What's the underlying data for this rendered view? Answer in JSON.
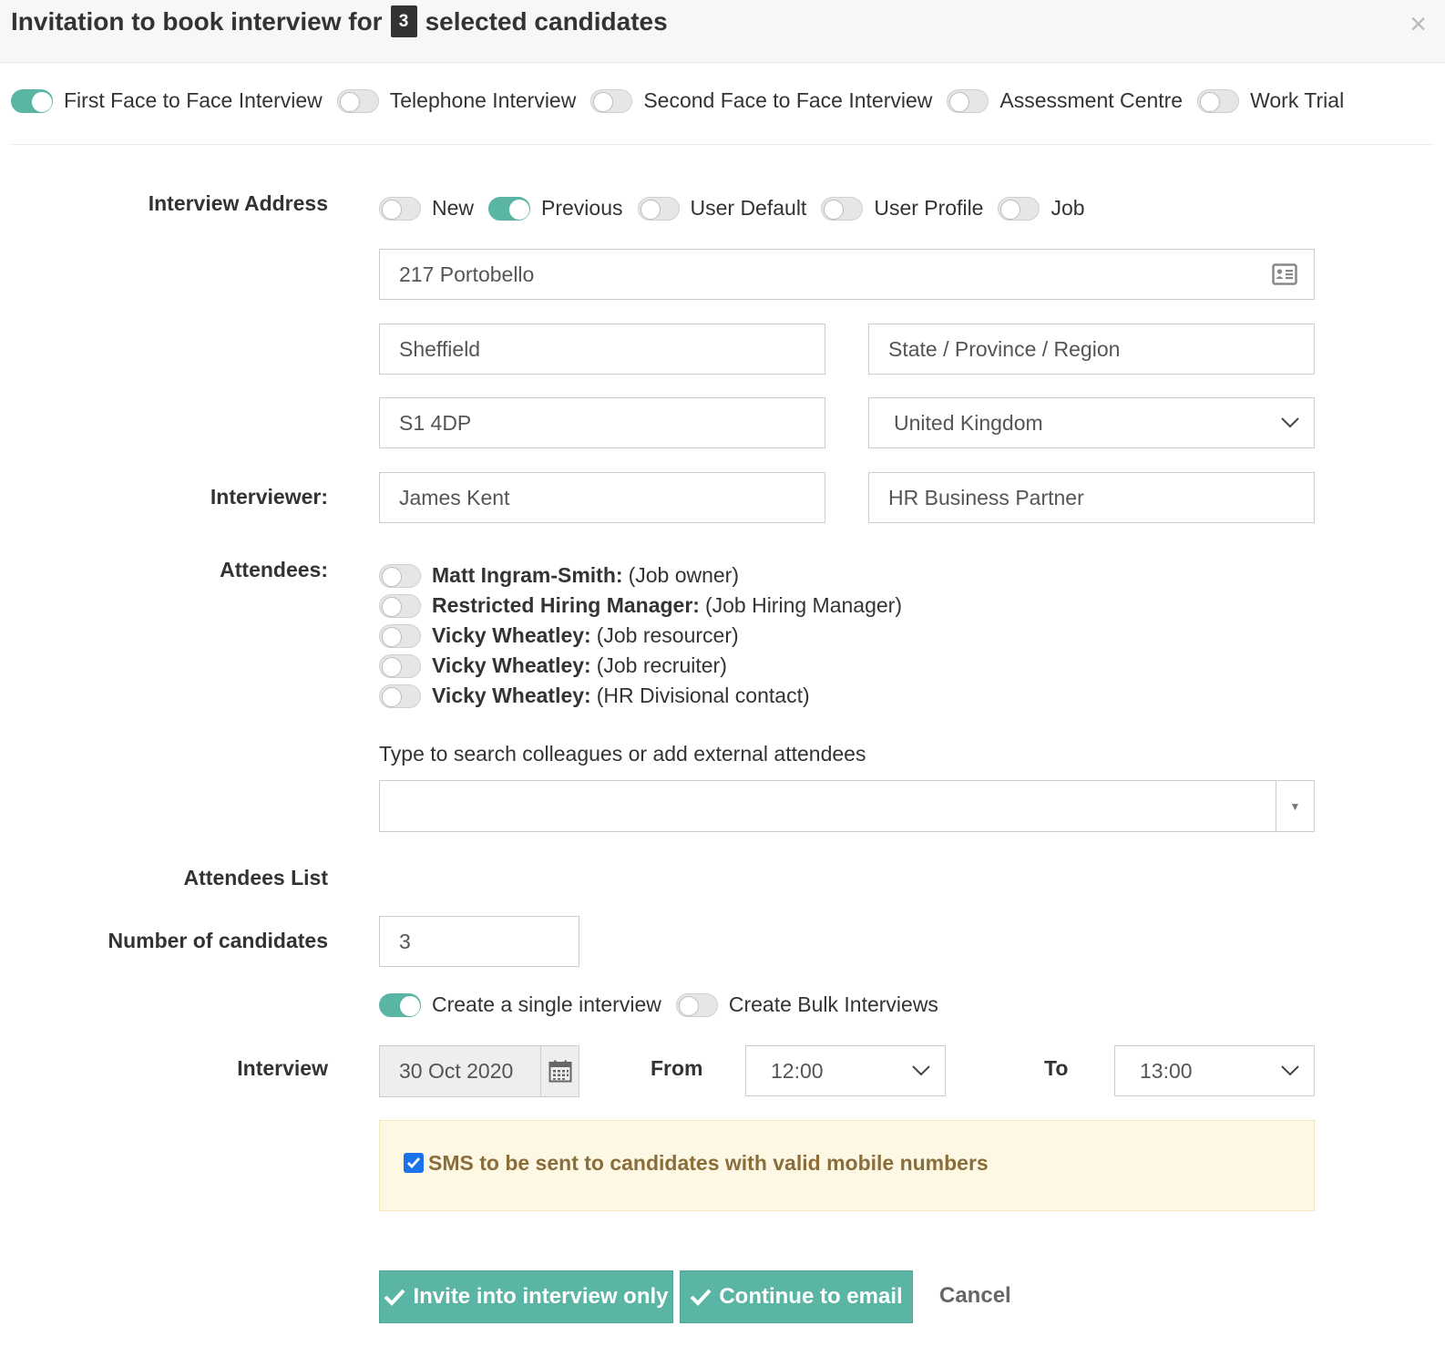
{
  "header": {
    "title_prefix": "Invitation to book interview for",
    "selected_count": "3",
    "title_suffix": "selected candidates",
    "close_label": "×"
  },
  "interview_types": [
    {
      "label": "First Face to Face Interview",
      "on": true
    },
    {
      "label": "Telephone Interview",
      "on": false
    },
    {
      "label": "Second Face to Face Interview",
      "on": false
    },
    {
      "label": "Assessment Centre",
      "on": false
    },
    {
      "label": "Work Trial",
      "on": false
    }
  ],
  "address": {
    "label": "Interview Address",
    "sources": [
      {
        "label": "New",
        "on": false
      },
      {
        "label": "Previous",
        "on": true
      },
      {
        "label": "User Default",
        "on": false
      },
      {
        "label": "User Profile",
        "on": false
      },
      {
        "label": "Job",
        "on": false
      }
    ],
    "street": "217 Portobello",
    "city": "Sheffield",
    "region_placeholder": "State / Province / Region",
    "postcode": "S1 4DP",
    "country": "United Kingdom"
  },
  "interviewer": {
    "label": "Interviewer:",
    "name": "James Kent",
    "title": "HR Business Partner"
  },
  "attendees": {
    "label": "Attendees:",
    "items": [
      {
        "name": "Matt Ingram-Smith:",
        "role": "(Job owner)",
        "on": false
      },
      {
        "name": "Restricted Hiring Manager:",
        "role": "(Job Hiring Manager)",
        "on": false
      },
      {
        "name": "Vicky Wheatley:",
        "role": "(Job resourcer)",
        "on": false
      },
      {
        "name": "Vicky Wheatley:",
        "role": "(Job recruiter)",
        "on": false
      },
      {
        "name": "Vicky Wheatley:",
        "role": "(HR Divisional contact)",
        "on": false
      }
    ],
    "search_label": "Type to search colleagues or add external attendees",
    "search_value": "",
    "list_label": "Attendees List"
  },
  "candidates": {
    "label": "Number of candidates",
    "value": "3"
  },
  "mode": [
    {
      "label": "Create a single interview",
      "on": true
    },
    {
      "label": "Create Bulk Interviews",
      "on": false
    }
  ],
  "schedule": {
    "label": "Interview",
    "date": "30 Oct 2020",
    "from_label": "From",
    "from": "12:00",
    "to_label": "To",
    "to": "13:00"
  },
  "sms": {
    "checked": true,
    "text": "SMS to be sent to candidates with valid mobile numbers"
  },
  "actions": {
    "invite_label": "Invite into interview only",
    "email_label": "Continue to email",
    "cancel_label": "Cancel"
  },
  "colors": {
    "accent": "#5bb5a5",
    "warning_bg": "#fcf8e3",
    "warning_text": "#8a6d3b"
  }
}
